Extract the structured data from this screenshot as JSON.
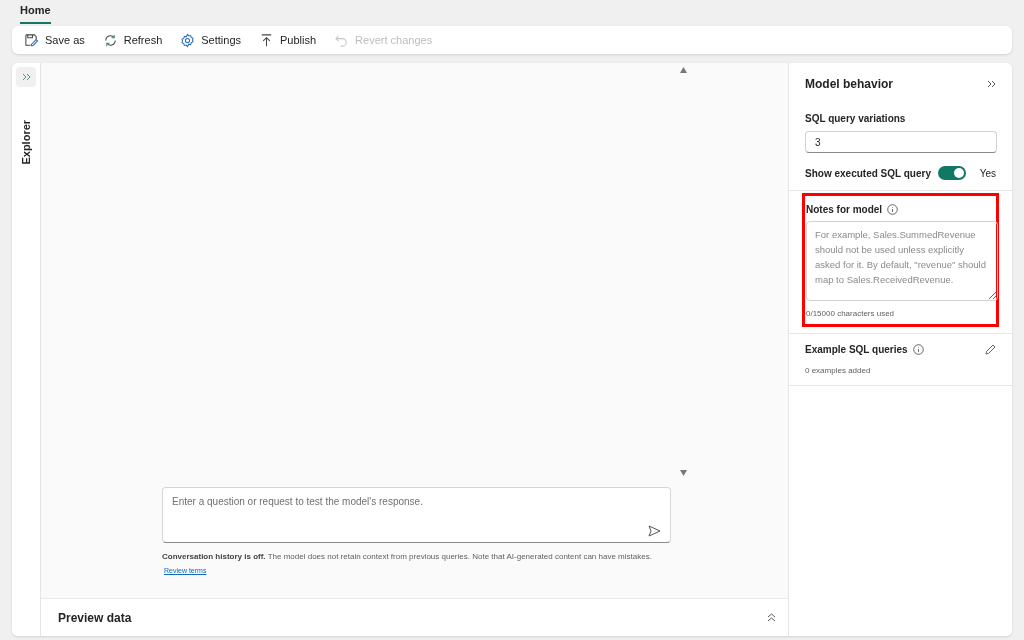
{
  "tabs": [
    {
      "label": "Home",
      "selected": true
    }
  ],
  "toolbar": [
    {
      "kind": "save",
      "label": "Save as",
      "disabled": false
    },
    {
      "kind": "refresh",
      "label": "Refresh",
      "disabled": false
    },
    {
      "kind": "settings",
      "label": "Settings",
      "disabled": false
    },
    {
      "kind": "publish",
      "label": "Publish",
      "disabled": false
    },
    {
      "kind": "revert",
      "label": "Revert changes",
      "disabled": true
    }
  ],
  "explorer": {
    "label": "Explorer"
  },
  "chat": {
    "placeholder": "Enter a question or request to test the model's response.",
    "disclaimer": "**Conversation history is off.** The model does not retain context from previous queries. Note that AI-generated content can have mistakes.",
    "link": "Review terms"
  },
  "preview": {
    "title": "Preview data"
  },
  "model_behavior": {
    "title": "Model behavior",
    "variations_label": "SQL query variations",
    "variations_value": "3",
    "show_sql_label": "Show executed SQL query",
    "show_sql_on": true,
    "show_sql_state": "Yes",
    "notes_label": "Notes for model",
    "notes_placeholder": "For example, Sales.SummedRevenue should not be used unless explicitly asked for it. By default, \"revenue\" should map to Sales.ReceivedRevenue.",
    "notes_counter": "0/15000 characters used",
    "examples_label": "Example SQL queries",
    "examples_count": "0 examples added"
  }
}
